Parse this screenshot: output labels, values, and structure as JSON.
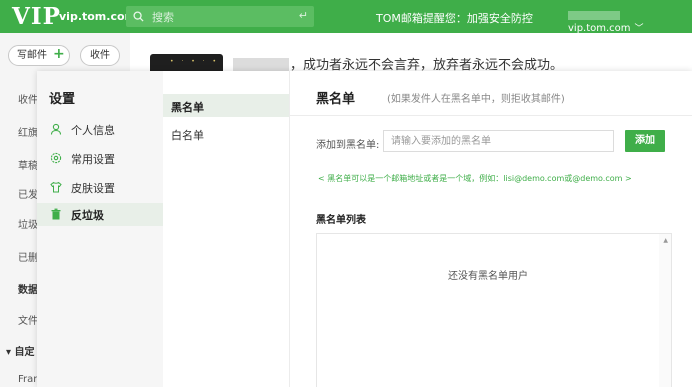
{
  "topbar": {
    "logo": "VIP",
    "domain": "vip.tom.com",
    "search_placeholder": "搜索",
    "search_enter_symbol": "↵",
    "notice": "TOM邮箱提醒您：加强安全防控",
    "user_domain": "vip.tom.com",
    "user_chevron": "﹀",
    "accent_color": "#3fae49"
  },
  "mail_nav": {
    "compose": "写邮件",
    "collect": "收件",
    "items": [
      "收件",
      "红旗",
      "草稿",
      "已发",
      "垃圾",
      "已删",
      "数据",
      "文件",
      "自定",
      "Fran"
    ]
  },
  "banner": {
    "motto": "，成功者永远不会言弃，放弃者永远不会成功。",
    "dots": "• · • · •"
  },
  "settings": {
    "title": "设置",
    "menu": [
      {
        "label": "个人信息",
        "icon": "user-icon"
      },
      {
        "label": "常用设置",
        "icon": "gear-icon"
      },
      {
        "label": "皮肤设置",
        "icon": "shirt-icon"
      },
      {
        "label": "反垃圾",
        "icon": "trash-icon"
      }
    ],
    "active_menu": "反垃圾",
    "submenu": [
      {
        "label": "黑名单"
      },
      {
        "label": "白名单"
      }
    ],
    "active_submenu": "黑名单",
    "panel": {
      "title": "黑名单",
      "desc": "(如果发件人在黑名单中，则拒收其邮件)",
      "add_label": "添加到黑名单:",
      "add_placeholder": "请输入要添加的黑名单",
      "add_button": "添加",
      "hint": "< 黑名单可以是一个邮箱地址或者是一个域，例如：lisi@demo.com或@demo.com >",
      "list_title": "黑名单列表",
      "empty_text": "还没有黑名单用户"
    }
  }
}
